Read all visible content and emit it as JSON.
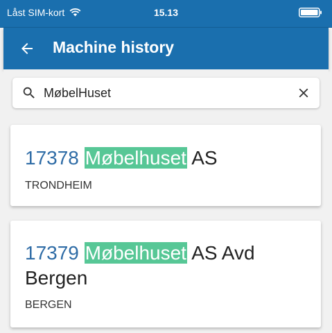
{
  "status_bar": {
    "carrier": "Låst SIM-kort",
    "time": "15.13"
  },
  "app_bar": {
    "title": "Machine history"
  },
  "search": {
    "value": "MøbelHuset"
  },
  "results": [
    {
      "number": "17378",
      "highlight": "Møbelhuset",
      "rest_line1": "AS",
      "rest_line2": "",
      "city": "TRONDHEIM"
    },
    {
      "number": "17379",
      "highlight": "Møbelhuset",
      "rest_line1": "AS Avd",
      "rest_line2": "Bergen",
      "city": "BERGEN"
    }
  ],
  "colors": {
    "app_bar": "#1a6fae",
    "number_text": "#2f6ca6",
    "highlight": "#57c796",
    "background": "#f1f1f1"
  }
}
